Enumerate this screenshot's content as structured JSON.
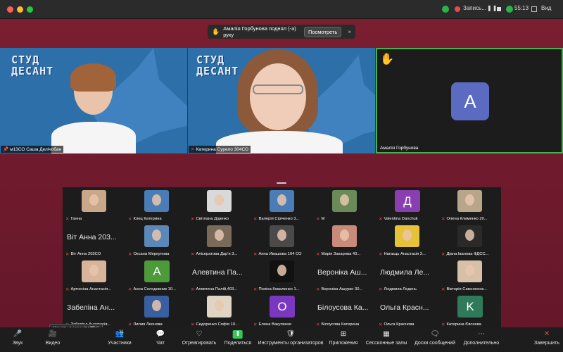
{
  "window": {
    "recording_label": "Запись...",
    "time": "55:13",
    "view_label": "Вид"
  },
  "toast": {
    "message": "Амалія Горбунова поднял (-а) руку",
    "button": "Посмотреть"
  },
  "logo": {
    "line1": "СТУД",
    "line2": "ДЕСАНТ"
  },
  "main_tiles": [
    {
      "name": "м13СО Саша Делічобан"
    },
    {
      "name": "Катерина Сурело 304СО"
    },
    {
      "name": "Амалія Горбунова",
      "avatar_letter": "A",
      "hand_icon": "raised-hand-icon"
    }
  ],
  "gallery": [
    {
      "name": "Ганна",
      "kind": "photo",
      "color": "#caa789"
    },
    {
      "name": "Клец Катерина",
      "kind": "photo",
      "color": "#4a7db5"
    },
    {
      "name": "Світлана Діденко",
      "kind": "photo",
      "color": "#d9d9d9"
    },
    {
      "name": "Валерія Сіріченко 3...",
      "kind": "photo",
      "color": "#4a7db5"
    },
    {
      "name": "М",
      "kind": "photo",
      "color": "#6a8a5a"
    },
    {
      "name": "Valentina Danchuk",
      "kind": "letter",
      "letter": "Д",
      "color": "#8a3fb0"
    },
    {
      "name": "Олена Клименко 20...",
      "kind": "photo",
      "color": "#b9a58a"
    },
    {
      "name": "Віт Анна 203СО",
      "kind": "text",
      "text": "Віт Анна 203..."
    },
    {
      "name": "Оксана Меркулова",
      "kind": "photo",
      "color": "#5a88b8"
    },
    {
      "name": "Аліспратова Дар'я 3...",
      "kind": "photo",
      "color": "#7a6a5a"
    },
    {
      "name": "Анна Ивашова 104 СО",
      "kind": "photo",
      "color": "#4a4a4a"
    },
    {
      "name": "Марія Захарова 40...",
      "kind": "photo",
      "color": "#c98a7a"
    },
    {
      "name": "Нагаєць Анастасія 2...",
      "kind": "photo",
      "color": "#e6c23a"
    },
    {
      "name": "Діана Іванова ФДСС...",
      "kind": "photo",
      "color": "#2a2a2a"
    },
    {
      "name": "Артюніна Анастасія...",
      "kind": "photo",
      "color": "#d8b49a"
    },
    {
      "name": "Анна Солодовник 10...",
      "kind": "letter",
      "letter": "A",
      "color": "#4c9a3a"
    },
    {
      "name": "Алевтина Палій,403...",
      "kind": "text",
      "text": "Алевтина Па..."
    },
    {
      "name": "Поліна Коваленко 1...",
      "kind": "photo",
      "color": "#111111"
    },
    {
      "name": "Вероніка Ашурко 30...",
      "kind": "text",
      "text": "Вероніка Аш..."
    },
    {
      "name": "Людмила Ледень",
      "kind": "text",
      "text": "Людмила Ле..."
    },
    {
      "name": "Вікторія Самсоненк...",
      "kind": "photo",
      "color": "#d8c0a8"
    },
    {
      "name": "Забеліна Анастасія...",
      "kind": "text",
      "text": "Забеліна Ан..."
    },
    {
      "name": "Лилия Леонова",
      "kind": "photo",
      "color": "#3a5fa0"
    },
    {
      "name": "Сидоренко Софія 10...",
      "kind": "photo",
      "color": "#e0d4c4"
    },
    {
      "name": "Елена Вакуленко",
      "kind": "letter",
      "letter": "O",
      "color": "#7a38c0"
    },
    {
      "name": "Білоусова Катерина",
      "kind": "text",
      "text": "Білоусова Ка..."
    },
    {
      "name": "Ольга Краснова",
      "kind": "text",
      "text": "Ольга Красн..."
    },
    {
      "name": "Катерина Євсеєва",
      "kind": "letter",
      "letter": "K",
      "color": "#2e7a5a"
    }
  ],
  "toolbar": {
    "tooltip": "Начать видео (⌥⌘V)",
    "items": [
      {
        "label": "Звук",
        "icon": "mic-muted-icon"
      },
      {
        "label": "Видео",
        "icon": "video-off-icon"
      },
      {
        "label": "Участники",
        "icon": "participants-icon",
        "count": "31"
      },
      {
        "label": "Чат",
        "icon": "chat-icon"
      },
      {
        "label": "Отреагировать",
        "icon": "heart-icon"
      },
      {
        "label": "Поделиться",
        "icon": "share-icon"
      },
      {
        "label": "Инструменты организаторов",
        "icon": "shield-icon"
      },
      {
        "label": "Приложения",
        "icon": "apps-icon"
      },
      {
        "label": "Сессионные залы",
        "icon": "breakout-icon"
      },
      {
        "label": "Доски сообщений",
        "icon": "whiteboard-icon"
      },
      {
        "label": "Дополнительно",
        "icon": "more-icon"
      },
      {
        "label": "Завершить",
        "icon": "end-icon"
      }
    ]
  },
  "colors": {
    "background": "#6e1a2a",
    "accent_green": "#35c759",
    "end_red": "#e24c4c",
    "active_speaker_border": "#4caf50"
  }
}
